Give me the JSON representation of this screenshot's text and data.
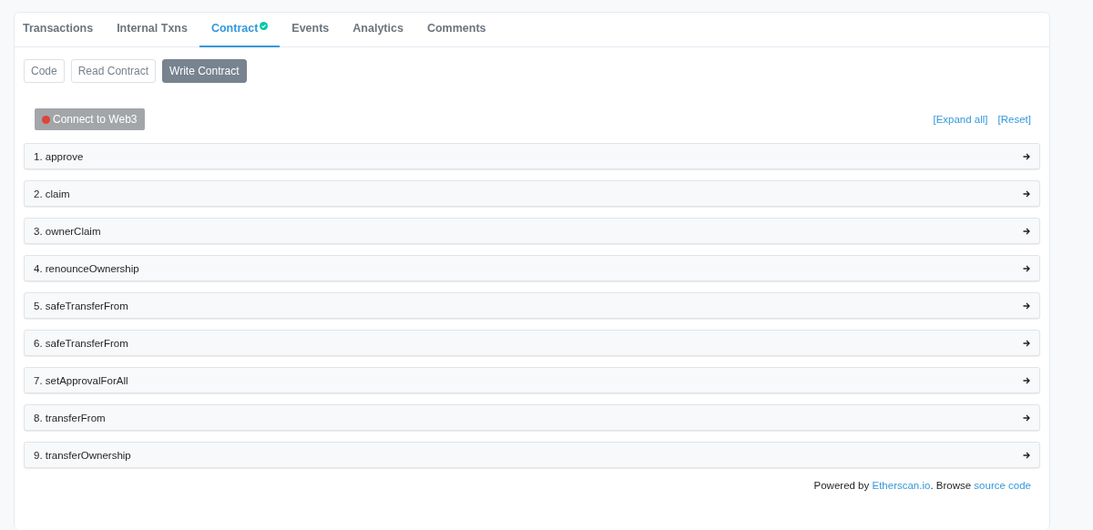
{
  "tabs": [
    {
      "label": "Transactions",
      "selected": false,
      "verified": false
    },
    {
      "label": "Internal Txns",
      "selected": false,
      "verified": false
    },
    {
      "label": "Contract",
      "selected": true,
      "verified": true
    },
    {
      "label": "Events",
      "selected": false,
      "verified": false
    },
    {
      "label": "Analytics",
      "selected": false,
      "verified": false
    },
    {
      "label": "Comments",
      "selected": false,
      "verified": false
    }
  ],
  "views": [
    {
      "label": "Code",
      "selected": false
    },
    {
      "label": "Read Contract",
      "selected": false
    },
    {
      "label": "Write Contract",
      "selected": true
    }
  ],
  "connect": {
    "label": "Connect to Web3",
    "connected": false
  },
  "links": [
    "[Expand all]",
    "[Reset]"
  ],
  "functions": [
    {
      "label": "1. approve",
      "expanded": false
    },
    {
      "label": "2. claim",
      "expanded": false
    },
    {
      "label": "3. ownerClaim",
      "expanded": false
    },
    {
      "label": "4. renounceOwnership",
      "expanded": false
    },
    {
      "label": "5. safeTransferFrom",
      "expanded": false
    },
    {
      "label": "6. safeTransferFrom",
      "expanded": false
    },
    {
      "label": "7. setApprovalForAll",
      "expanded": false
    },
    {
      "label": "8. transferFrom",
      "expanded": false
    },
    {
      "label": "9. transferOwnership",
      "expanded": false
    }
  ],
  "footer": {
    "prefix": "Powered by ",
    "site_link": "Etherscan.io",
    "middle": ". Browse ",
    "source_link": "source code"
  }
}
